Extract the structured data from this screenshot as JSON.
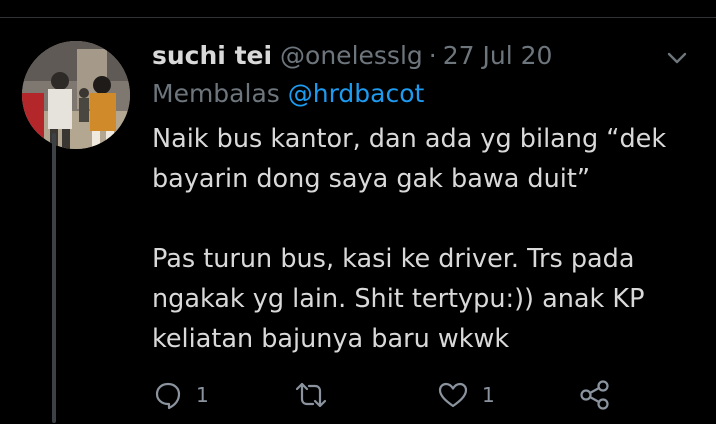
{
  "tweet": {
    "display_name": "suchi tei",
    "handle": "@onelesslg",
    "separator": "·",
    "date": "27 Jul 20",
    "reply_prefix": "Membalas",
    "reply_to": "@hrdbacot",
    "body": {
      "line1": "Naik bus kantor, dan ada yg bilang “dek",
      "line2": "bayarin dong saya gak bawa duit”",
      "line3": "Pas turun bus, kasi ke driver. Trs pada",
      "line4": "ngakak yg lain. Shit tertypu:)) anak KP",
      "line5": "keliatan bajunya baru wkwk"
    }
  },
  "actions": {
    "reply_count": "1",
    "retweet_count": "",
    "like_count": "1"
  },
  "icons": {
    "reply": "comment-bubble-icon",
    "retweet": "retweet-icon",
    "like": "heart-icon",
    "share": "share-icon",
    "more": "chevron-down-icon"
  },
  "colors": {
    "background": "#000000",
    "text": "#d9d9d9",
    "muted": "#6e767d",
    "link": "#1d9bf0",
    "thread_line": "#3d4145"
  }
}
